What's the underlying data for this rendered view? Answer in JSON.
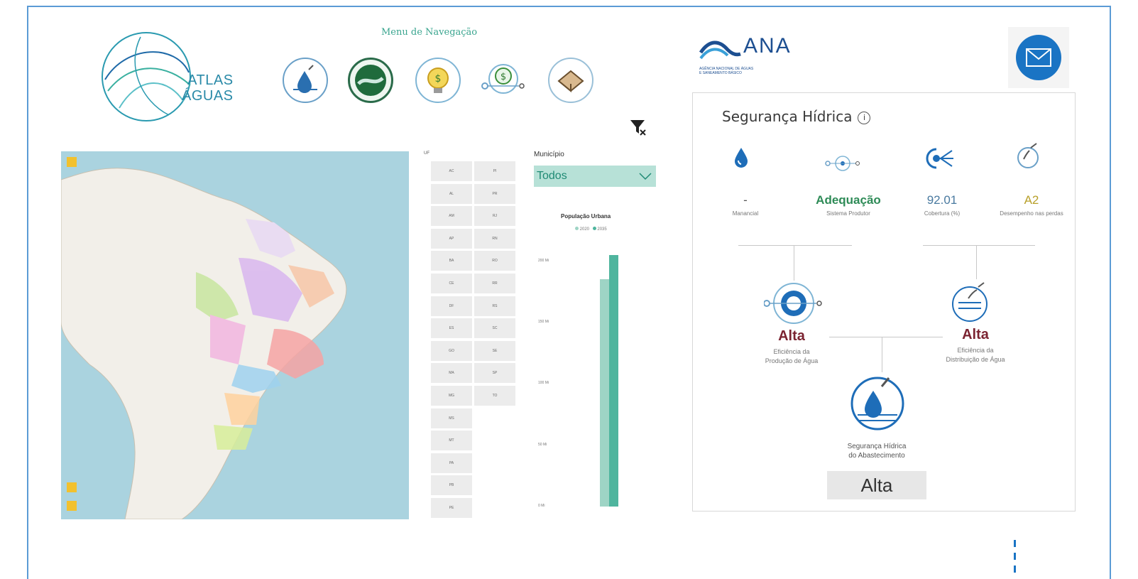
{
  "header": {
    "logo_line1": "ATLAS",
    "logo_line2": "ÁGUAS",
    "menu_title": "Menu de Navegação",
    "nav_items": [
      "nav-seguranca-hidrica",
      "nav-mananciais",
      "nav-investimentos",
      "nav-custos",
      "nav-abastecimento"
    ],
    "ana_name": "ANA",
    "ana_sub1": "AGÊNCIA NACIONAL DE ÁGUAS",
    "ana_sub2": "E SANEAMENTO BÁSICO",
    "accent": "#3aa58f",
    "brand": "#1a74c4"
  },
  "filters": {
    "uf_label": "UF",
    "uf_col1": [
      "AC",
      "AL",
      "AM",
      "AP",
      "BA",
      "CE",
      "DF",
      "ES",
      "GO",
      "MA",
      "MG",
      "MS",
      "MT",
      "PA",
      "PB",
      "PE"
    ],
    "uf_col2": [
      "PI",
      "PR",
      "RJ",
      "RN",
      "RO",
      "RR",
      "RS",
      "SC",
      "SE",
      "SP",
      "TO"
    ],
    "municipio_label": "Município",
    "municipio_value": "Todos"
  },
  "chart_data": {
    "type": "bar",
    "title": "População Urbana",
    "categories": [
      ""
    ],
    "series": [
      {
        "name": "2020",
        "values": [
          185
        ],
        "color": "#9ed4c5"
      },
      {
        "name": "2035",
        "values": [
          205
        ],
        "color": "#4fb59e"
      }
    ],
    "ylim": [
      0,
      220
    ],
    "yticks": [
      "0 Mi",
      "50 Mi",
      "100 Mi",
      "150 Mi",
      "200 Mi"
    ],
    "ytick_values": [
      0,
      50,
      100,
      150,
      200
    ]
  },
  "security": {
    "title": "Segurança Hídrica",
    "info_icon": "i",
    "indicators": [
      {
        "value": "-",
        "label": "Manancial",
        "color": "#555555"
      },
      {
        "value": "Adequação",
        "label": "Sistema Produtor",
        "color": "#2e8b57"
      },
      {
        "value": "92.01",
        "label": "Cobertura (%)",
        "color": "#4a7aa0"
      },
      {
        "value": "A2",
        "label": "Desempenho nas perdas",
        "color": "#b8a02a"
      }
    ],
    "production": {
      "value": "Alta",
      "label1": "Eficiência da",
      "label2": "Produção de Água"
    },
    "distribution": {
      "value": "Alta",
      "label1": "Eficiência da",
      "label2": "Distribuição de Água"
    },
    "final": {
      "label1": "Segurança Hídrica",
      "label2": "do Abastecimento",
      "value": "Alta"
    }
  }
}
